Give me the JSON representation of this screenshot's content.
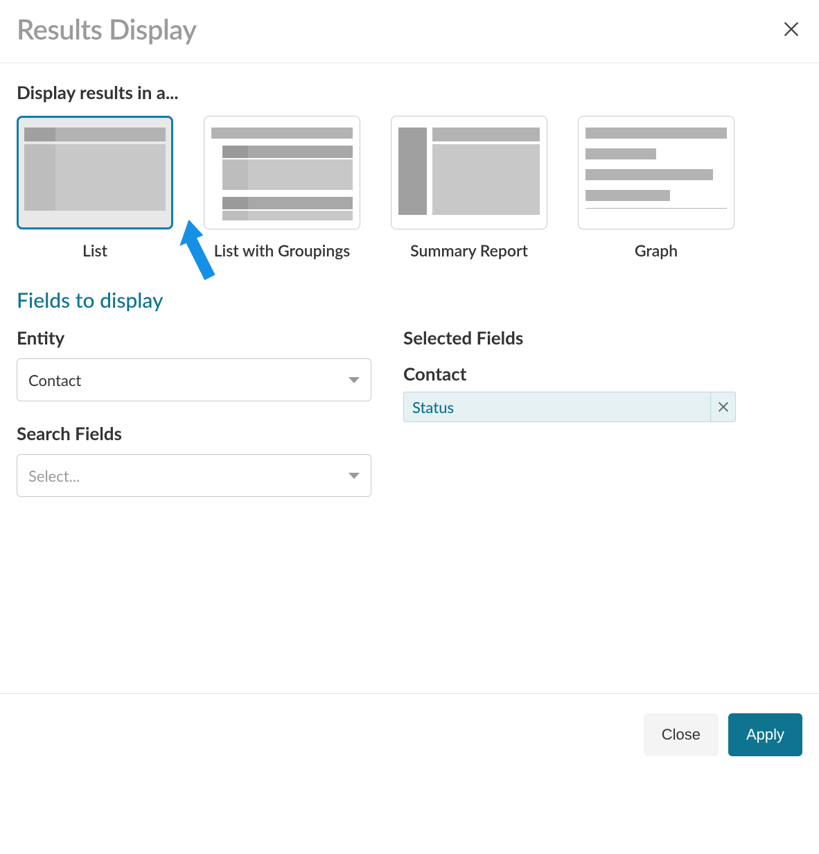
{
  "header": {
    "title": "Results Display"
  },
  "display_section": {
    "heading": "Display results in a...",
    "options": {
      "list": "List",
      "list_group": "List with Groupings",
      "summary": "Summary Report",
      "graph": "Graph"
    },
    "selected": "list"
  },
  "fields_section": {
    "heading": "Fields to display",
    "entity_label": "Entity",
    "entity_value": "Contact",
    "search_fields_label": "Search Fields",
    "search_fields_placeholder": "Select...",
    "selected_fields_label": "Selected Fields",
    "selected_group_label": "Contact",
    "selected_field_chip": "Status"
  },
  "footer": {
    "close": "Close",
    "apply": "Apply"
  }
}
